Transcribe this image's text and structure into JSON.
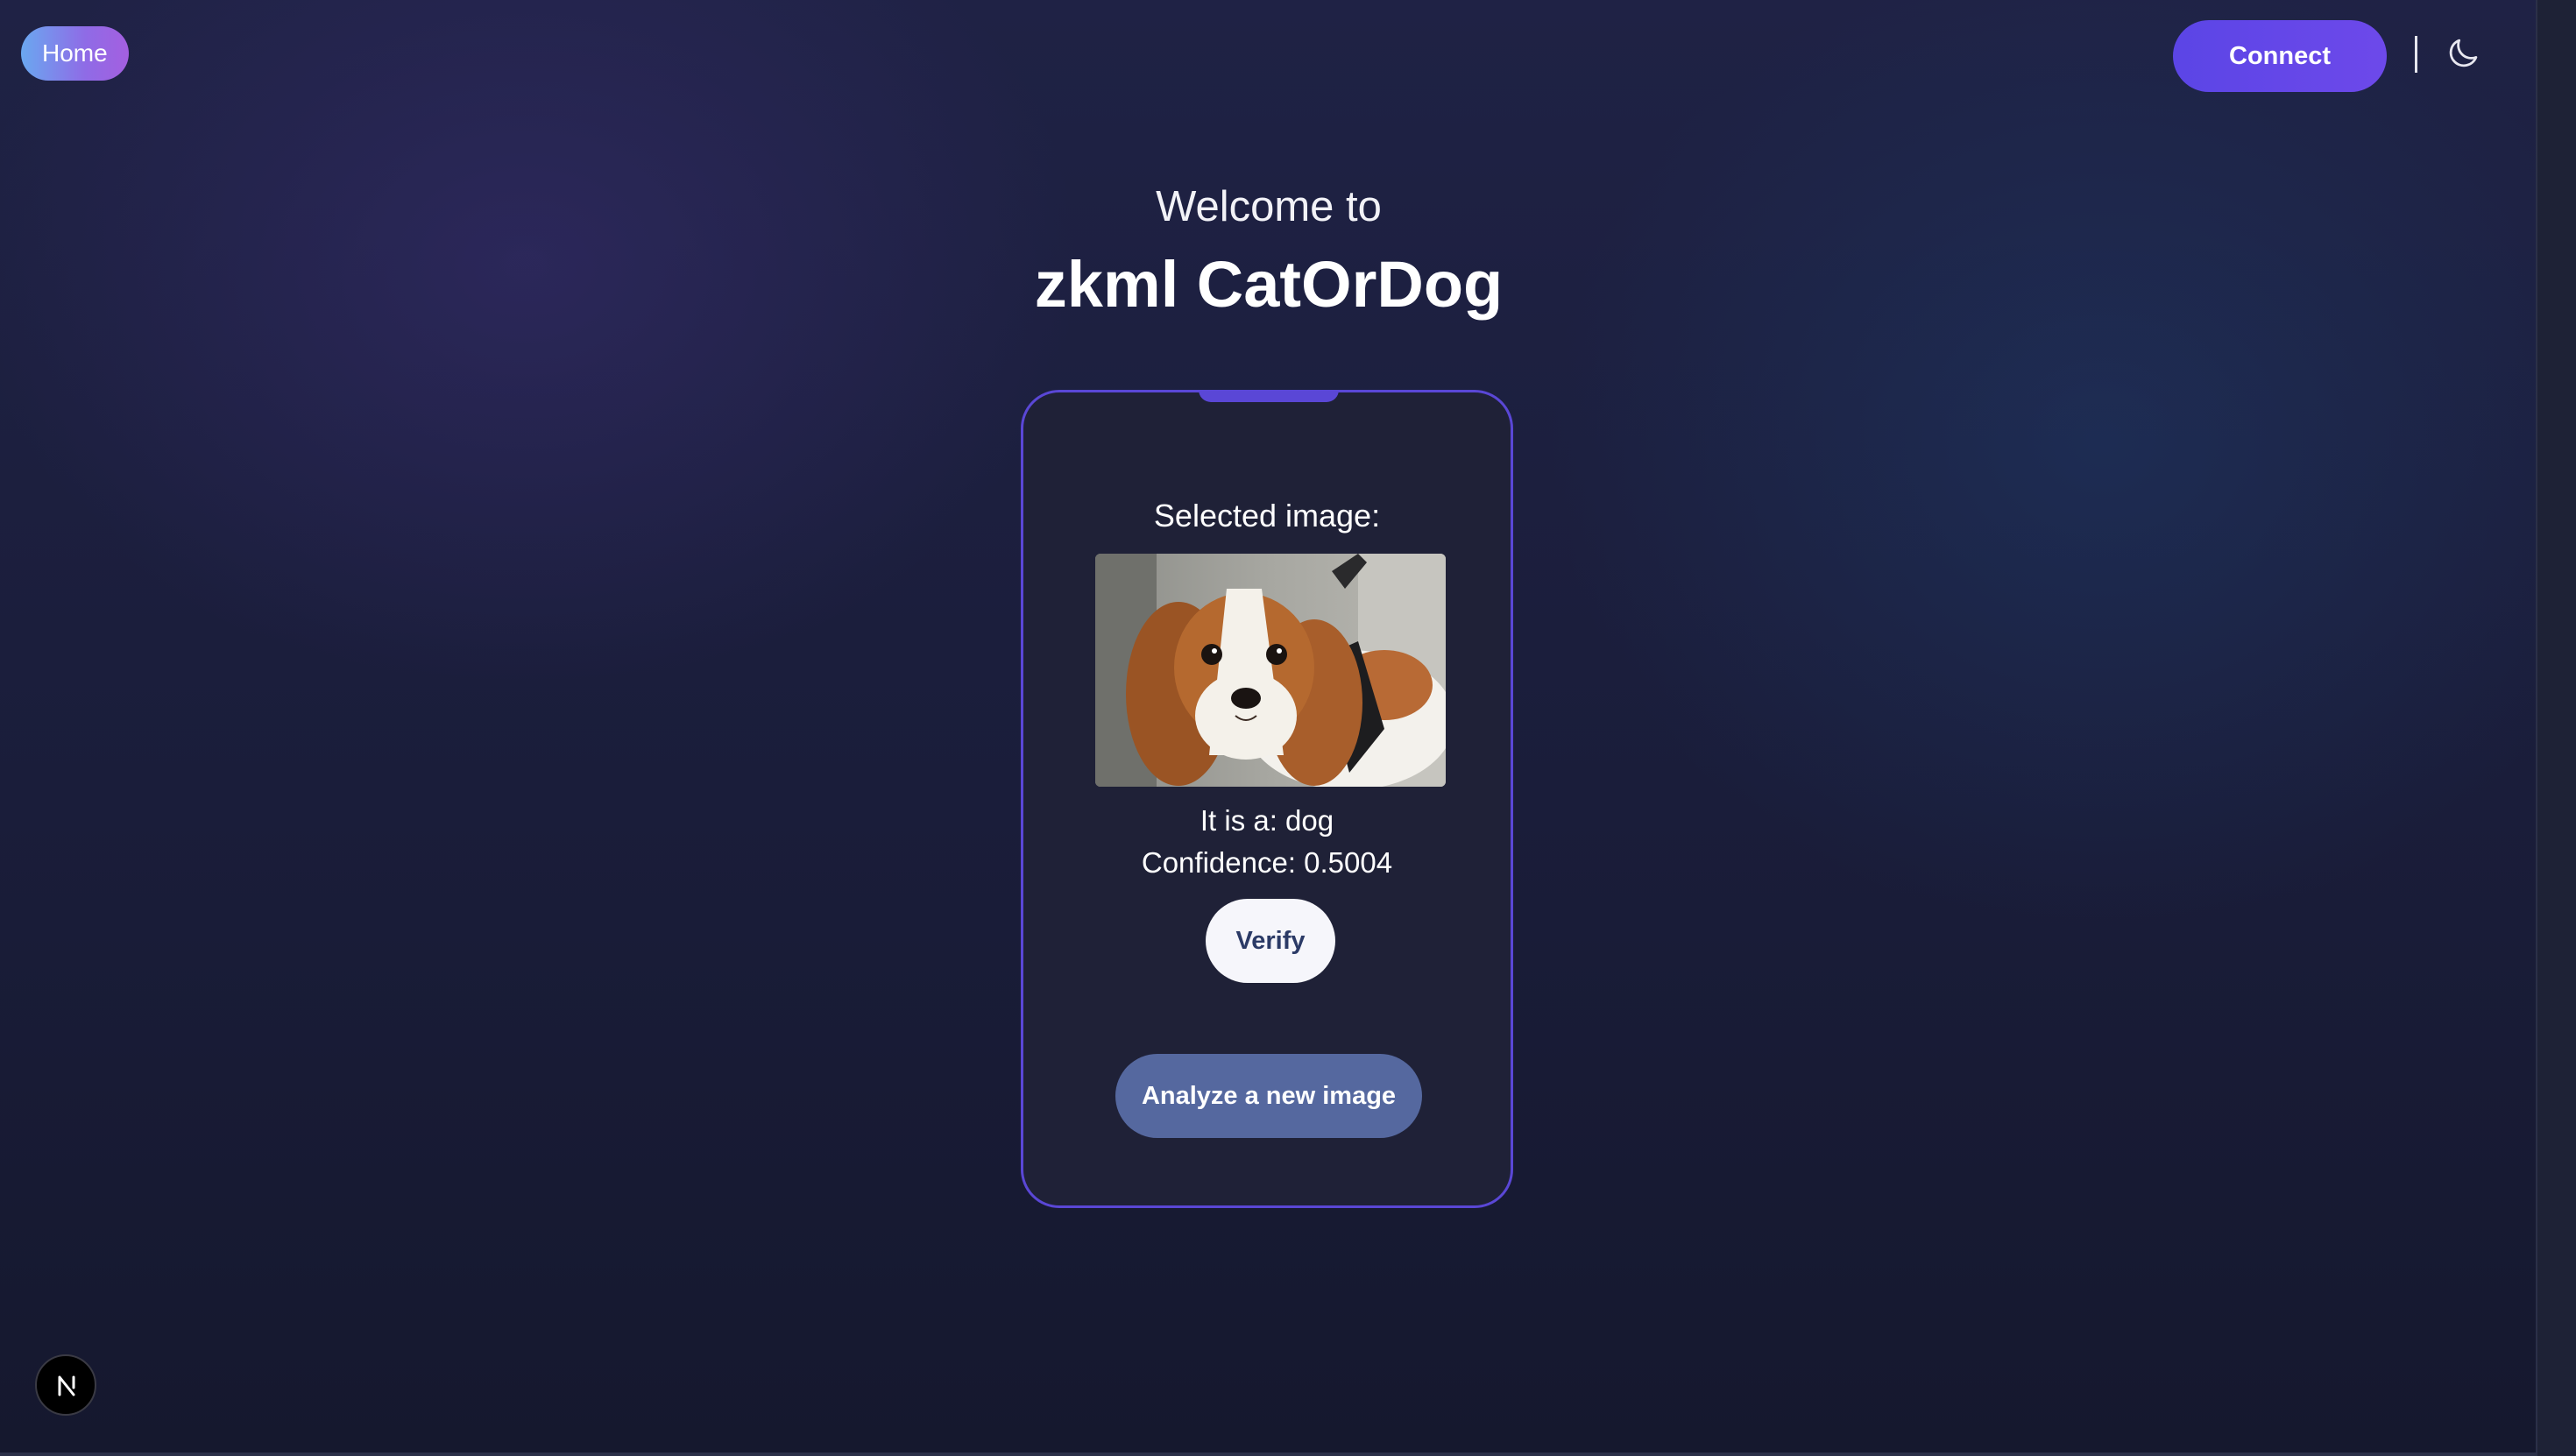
{
  "nav": {
    "home_label": "Home",
    "connect_label": "Connect",
    "theme_icon": "moon-icon"
  },
  "hero": {
    "welcome": "Welcome to",
    "title": "zkml CatOrDog"
  },
  "card": {
    "selected_label": "Selected image:",
    "image_subject": "Cavalier King Charles Spaniel dog photo",
    "result": "It is a: dog",
    "confidence": "Confidence: 0.5004",
    "verify_label": "Verify",
    "analyze_label": "Analyze a new image"
  },
  "dev_badge": {
    "icon": "nextjs-n-icon"
  },
  "colors": {
    "accent": "#5a47d6",
    "connect": "#6149e8",
    "analyze": "#55689f",
    "card_bg": "#1f2137"
  }
}
